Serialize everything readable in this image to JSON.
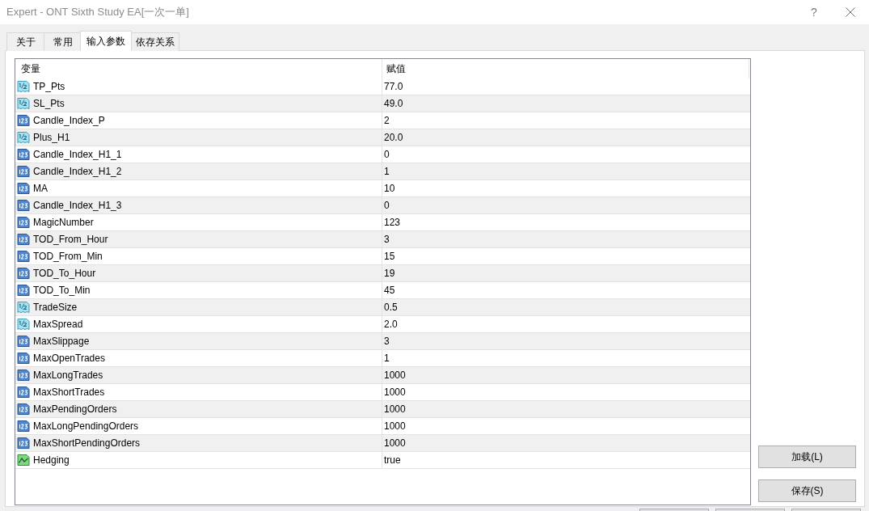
{
  "window": {
    "title": "Expert - ONT Sixth Study EA[一次一单]",
    "help": "?"
  },
  "tabs": [
    {
      "label": "关于",
      "selected": false
    },
    {
      "label": "常用",
      "selected": false
    },
    {
      "label": "输入参数",
      "selected": true
    },
    {
      "label": "依存关系",
      "selected": false
    }
  ],
  "table": {
    "columns": [
      "变量",
      "赋值"
    ],
    "rows": [
      {
        "kind": "double",
        "name": "TP_Pts",
        "value": "77.0"
      },
      {
        "kind": "double",
        "name": "SL_Pts",
        "value": "49.0"
      },
      {
        "kind": "int",
        "name": "Candle_Index_P",
        "value": "2"
      },
      {
        "kind": "double",
        "name": "Plus_H1",
        "value": "20.0"
      },
      {
        "kind": "int",
        "name": "Candle_Index_H1_1",
        "value": "0"
      },
      {
        "kind": "int",
        "name": "Candle_Index_H1_2",
        "value": "1"
      },
      {
        "kind": "int",
        "name": "MA",
        "value": "10"
      },
      {
        "kind": "int",
        "name": "Candle_Index_H1_3",
        "value": "0"
      },
      {
        "kind": "int",
        "name": "MagicNumber",
        "value": "123"
      },
      {
        "kind": "int",
        "name": "TOD_From_Hour",
        "value": "3"
      },
      {
        "kind": "int",
        "name": "TOD_From_Min",
        "value": "15"
      },
      {
        "kind": "int",
        "name": "TOD_To_Hour",
        "value": "19"
      },
      {
        "kind": "int",
        "name": "TOD_To_Min",
        "value": "45"
      },
      {
        "kind": "double",
        "name": "TradeSize",
        "value": "0.5"
      },
      {
        "kind": "double",
        "name": "MaxSpread",
        "value": "2.0"
      },
      {
        "kind": "int",
        "name": "MaxSlippage",
        "value": "3"
      },
      {
        "kind": "int",
        "name": "MaxOpenTrades",
        "value": "1"
      },
      {
        "kind": "int",
        "name": "MaxLongTrades",
        "value": "1000"
      },
      {
        "kind": "int",
        "name": "MaxShortTrades",
        "value": "1000"
      },
      {
        "kind": "int",
        "name": "MaxPendingOrders",
        "value": "1000"
      },
      {
        "kind": "int",
        "name": "MaxLongPendingOrders",
        "value": "1000"
      },
      {
        "kind": "int",
        "name": "MaxShortPendingOrders",
        "value": "1000"
      },
      {
        "kind": "bool",
        "name": "Hedging",
        "value": "true"
      }
    ]
  },
  "buttons": [
    "加载(L)",
    "保存(S)"
  ]
}
